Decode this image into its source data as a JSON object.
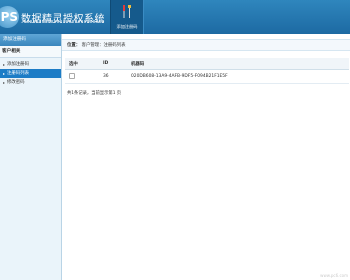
{
  "app": {
    "logo_letters": "PS",
    "title": "数据精灵授权系统"
  },
  "toolbar": {
    "add_code_label": "添加注册码"
  },
  "sidebar": {
    "header": "添加注册码",
    "section": "客户相关",
    "items": [
      {
        "label": "添加注册码",
        "active": false
      },
      {
        "label": "注册码列表",
        "active": true
      },
      {
        "label": "修改密码",
        "active": false
      }
    ]
  },
  "breadcrumb": {
    "prefix": "位置：",
    "path": "客户管理：注册码列表"
  },
  "table": {
    "columns": [
      "选中",
      "ID",
      "机器码"
    ],
    "rows": [
      {
        "id": "36",
        "code": "020DB608-13A9-4AFB-9DF5-F094B21F1E5F"
      }
    ]
  },
  "pagination": {
    "text": "共1条记录，当前显示第1 页"
  },
  "watermark": "www.pc6.com",
  "colors": {
    "accent": "#1c7cc6",
    "topbar": "#2f86bd"
  }
}
